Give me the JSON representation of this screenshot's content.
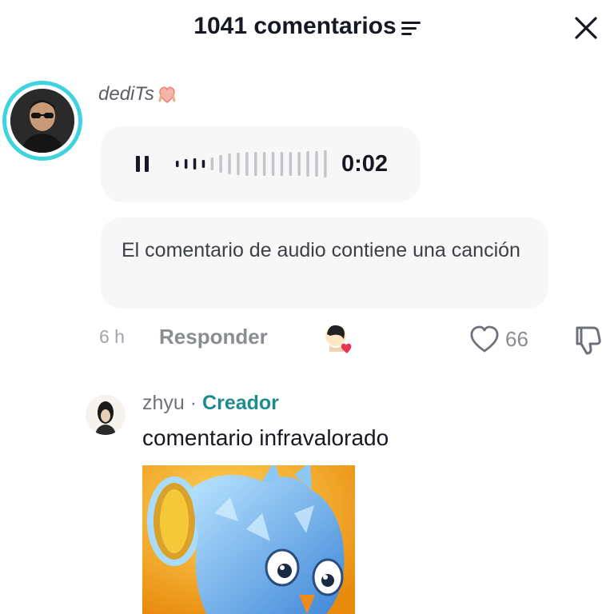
{
  "header": {
    "title": "1041 comentarios"
  },
  "comment1": {
    "username": "dediTs",
    "audio": {
      "duration": "0:02",
      "progress": 0.2
    },
    "notice": "El comentario de audio contiene una canción",
    "time": "6 h",
    "reply_label": "Responder",
    "like_count": "66"
  },
  "comment2": {
    "username": "zhyu",
    "separator": " · ",
    "badge": "Creador",
    "text": "comentario infravalorado"
  },
  "colors": {
    "accent_ring": "#3ed3df",
    "creator_badge": "#1d8c90",
    "heart": "#e8344f"
  },
  "icons": {
    "sort": "sort-lines-icon",
    "close": "close-icon",
    "pause": "pause-icon",
    "like": "heart-outline-icon",
    "dislike": "thumbs-down-icon"
  }
}
